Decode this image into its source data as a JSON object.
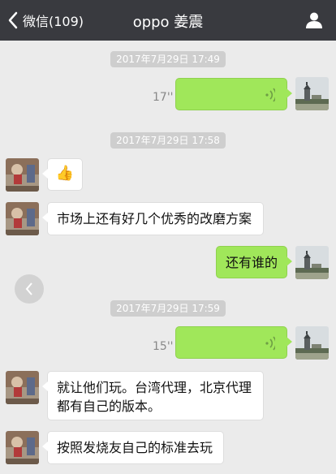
{
  "header": {
    "back_label": "微信(109)",
    "title": "oppo 姜震"
  },
  "messages": {
    "ts1": "2017年7月29日 17:49",
    "voice1_len": "17''",
    "ts2": "2017年7月29日 17:58",
    "thumbs_up": "👍",
    "text1": "市场上还有好几个优秀的改磨方案",
    "text2": "还有谁的",
    "ts3": "2017年7月29日 17:59",
    "voice2_len": "15''",
    "text3_line1": "就让他们玩。台湾代理，北京代理",
    "text3_line2": "都有自己的版本。",
    "text4": "按照发烧友自己的标准去玩"
  },
  "colors": {
    "navbar": "#393a3f",
    "background": "#ebebeb",
    "outgoing_bubble": "#a0e75a",
    "incoming_bubble": "#ffffff",
    "timestamp_pill": "#cecece"
  },
  "icons": {
    "back": "chevron-left-icon",
    "profile": "person-icon",
    "voice": "sound-wave-icon",
    "scroll": "chevron-left-circle-icon"
  }
}
